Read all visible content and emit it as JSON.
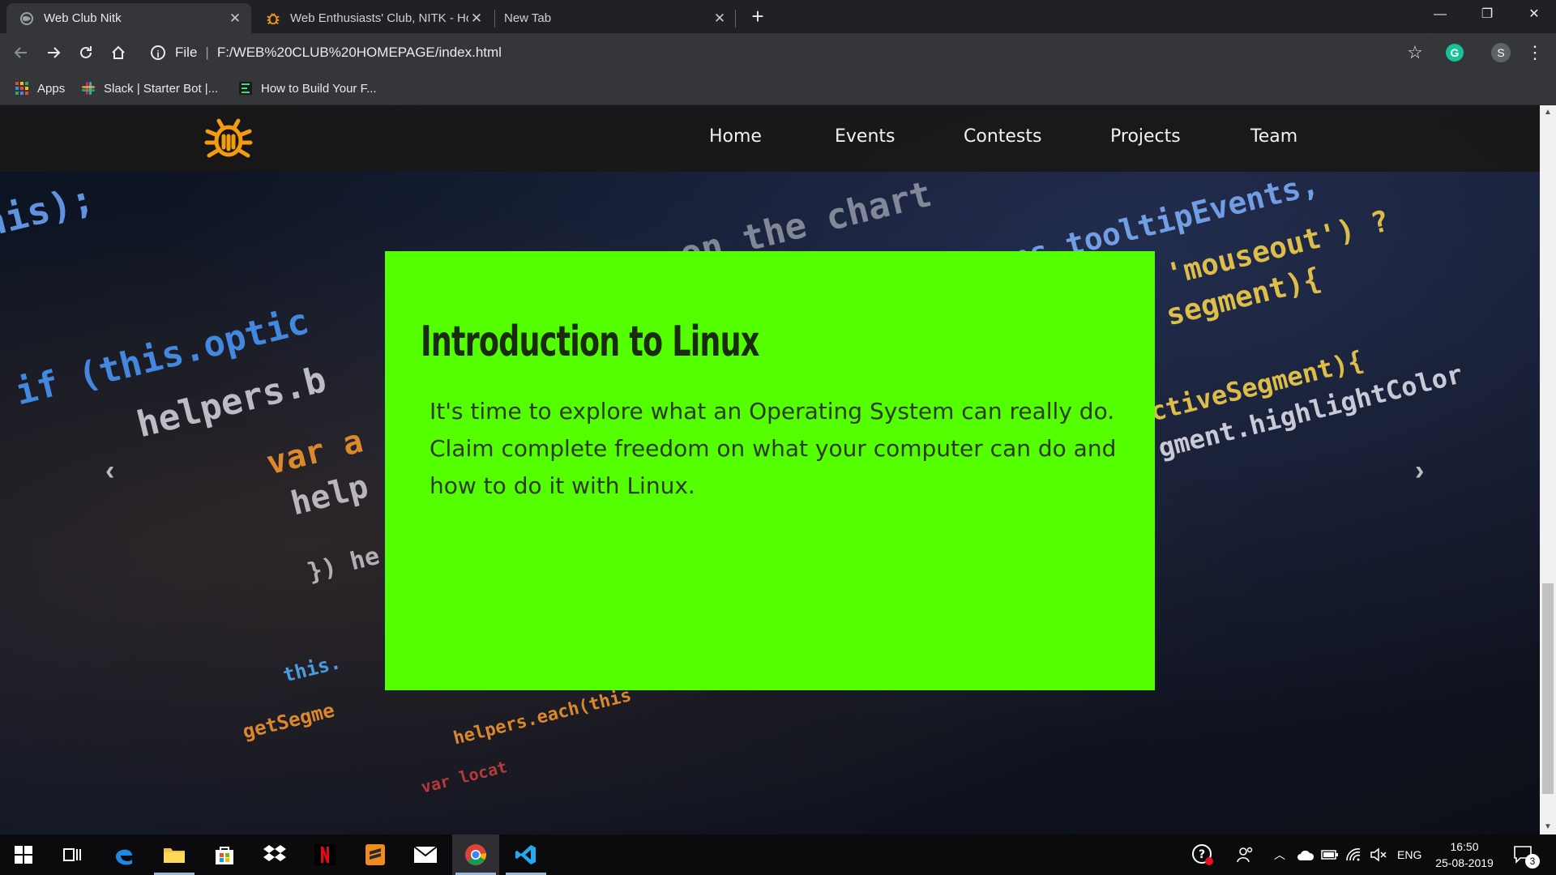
{
  "browser": {
    "tabs": [
      {
        "title": "Web Club Nitk",
        "active": true
      },
      {
        "title": "Web Enthusiasts' Club, NITK - Ho",
        "active": false
      },
      {
        "title": "New Tab",
        "active": false
      }
    ],
    "new_tab_glyph": "+",
    "window_controls": {
      "minimize": "—",
      "restore": "❐",
      "close": "✕"
    },
    "address": {
      "scheme_label": "File",
      "url": "F:/WEB%20CLUB%20HOMEPAGE/index.html"
    },
    "profile_initial": "S",
    "extension_initial": "G",
    "bookmarks": [
      {
        "label": "Apps",
        "icon": "apps-grid-icon"
      },
      {
        "label": "Slack | Starter Bot |...",
        "icon": "slack-icon"
      },
      {
        "label": "How to Build Your F...",
        "icon": "bookmark-site-icon"
      }
    ]
  },
  "site": {
    "logo_icon": "bug-icon",
    "nav": [
      "Home",
      "Events",
      "Contests",
      "Projects",
      "Team"
    ],
    "slide": {
      "title": "Introduction to Linux",
      "body": "It's time to explore what an Operating System can really do. Claim complete freedom on what your computer can do and how to do it with Linux."
    },
    "prev_glyph": "‹",
    "next_glyph": "›",
    "colors": {
      "card": "#53ff00",
      "logo": "#f39c12"
    }
  },
  "taskbar": {
    "language": "ENG",
    "time": "16:50",
    "date": "25-08-2019",
    "notification_count": "3"
  }
}
